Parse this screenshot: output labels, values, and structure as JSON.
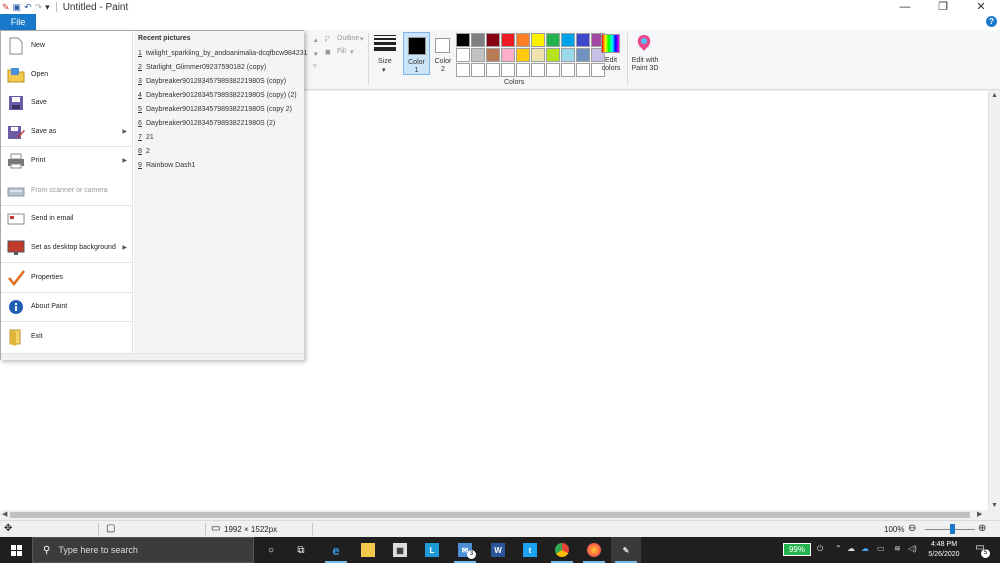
{
  "window": {
    "title": "Untitled - Paint",
    "controls": {
      "minimize": "—",
      "maximize": "❐",
      "close": "✕"
    }
  },
  "quick_access": {
    "dropdown": "▾"
  },
  "tabs": {
    "file": "File",
    "help": "?"
  },
  "ribbon": {
    "outline": "Outline",
    "fill": "Fill",
    "size": "Size",
    "color1": [
      "Color",
      "1"
    ],
    "color2": [
      "Color",
      "2"
    ],
    "colors_group": "Colors",
    "edit_colors": [
      "Edit",
      "colors"
    ],
    "edit_paint3d": [
      "Edit with",
      "Paint 3D"
    ],
    "color1_value": "#000000",
    "color2_value": "#ffffff",
    "palette": [
      "#000000",
      "#7f7f7f",
      "#880015",
      "#ed1c24",
      "#ff7f27",
      "#fff200",
      "#22b14c",
      "#00a2e8",
      "#3f48cc",
      "#a349a4",
      "#ffffff",
      "#c3c3c3",
      "#b97a57",
      "#ffaec9",
      "#ffc90e",
      "#efe4b0",
      "#b5e61d",
      "#99d9ea",
      "#7092be",
      "#c8bfe7",
      "#ffffff",
      "#ffffff",
      "#ffffff",
      "#ffffff",
      "#ffffff",
      "#ffffff",
      "#ffffff",
      "#ffffff",
      "#ffffff",
      "#ffffff"
    ]
  },
  "file_menu": {
    "items": [
      {
        "label": "New",
        "icon": "new-file-icon",
        "chevron": false,
        "dim": false
      },
      {
        "label": "Open",
        "icon": "open-folder-icon",
        "chevron": false,
        "dim": false
      },
      {
        "label": "Save",
        "icon": "save-disk-icon",
        "chevron": false,
        "dim": false
      },
      {
        "label": "Save as",
        "icon": "save-as-icon",
        "chevron": true,
        "dim": false
      },
      {
        "label": "Print",
        "icon": "printer-icon",
        "chevron": true,
        "dim": false
      },
      {
        "label": "From scanner or camera",
        "icon": "scanner-icon",
        "chevron": false,
        "dim": true
      },
      {
        "label": "Send in email",
        "icon": "email-icon",
        "chevron": false,
        "dim": false
      },
      {
        "label": "Set as desktop background",
        "icon": "desktop-background-icon",
        "chevron": true,
        "dim": false
      },
      {
        "label": "Properties",
        "icon": "checkmark-icon",
        "chevron": false,
        "dim": false
      },
      {
        "label": "About Paint",
        "icon": "info-icon",
        "chevron": false,
        "dim": false
      },
      {
        "label": "Exit",
        "icon": "exit-icon",
        "chevron": false,
        "dim": false
      }
    ],
    "recent_title": "Recent pictures",
    "recent": [
      {
        "num": "1",
        "name": "twilight_sparkling_by_andoanimalia-dcqfbcw984231"
      },
      {
        "num": "2",
        "name": "Starlight_Glimmer09237590182 (copy)"
      },
      {
        "num": "3",
        "name": "Daybreaker90128345798938221980S (copy)"
      },
      {
        "num": "4",
        "name": "Daybreaker90128345798938221980S (copy) (2)"
      },
      {
        "num": "5",
        "name": "Daybreaker90128345798938221980S (copy 2)"
      },
      {
        "num": "6",
        "name": "Daybreaker90128345798938221980S (2)"
      },
      {
        "num": "7",
        "name": "21"
      },
      {
        "num": "8",
        "name": "2"
      },
      {
        "num": "9",
        "name": "Rainbow Dash1"
      }
    ]
  },
  "status": {
    "dimensions": "1992 × 1522px",
    "zoom": "100%",
    "zoom_out": "⊖",
    "zoom_in": "⊕"
  },
  "taskbar": {
    "search_placeholder": "Type here to search",
    "battery": "99%",
    "time": "4:48 PM",
    "date": "5/26/2020",
    "notifications": "5",
    "mail_badge": "3"
  }
}
